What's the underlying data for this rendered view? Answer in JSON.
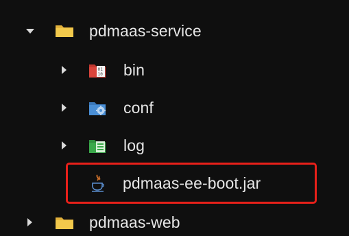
{
  "tree": {
    "items": [
      {
        "label": "pdmaas-service",
        "icon": "folder-icon",
        "expanded": true
      },
      {
        "label": "bin",
        "icon": "binary-folder-icon",
        "expanded": false
      },
      {
        "label": "conf",
        "icon": "config-folder-icon",
        "expanded": false
      },
      {
        "label": "log",
        "icon": "log-folder-icon",
        "expanded": false
      },
      {
        "label": "pdmaas-ee-boot.jar",
        "icon": "java-jar-icon",
        "selected": true
      },
      {
        "label": "pdmaas-web",
        "icon": "folder-icon",
        "expanded": false
      }
    ]
  },
  "colors": {
    "background": "#0f0f0f",
    "folder": "#f2c94c",
    "bin": "#d9443b",
    "conf": "#4a8fd6",
    "log": "#3aa84a",
    "highlight": "#e8201a"
  }
}
